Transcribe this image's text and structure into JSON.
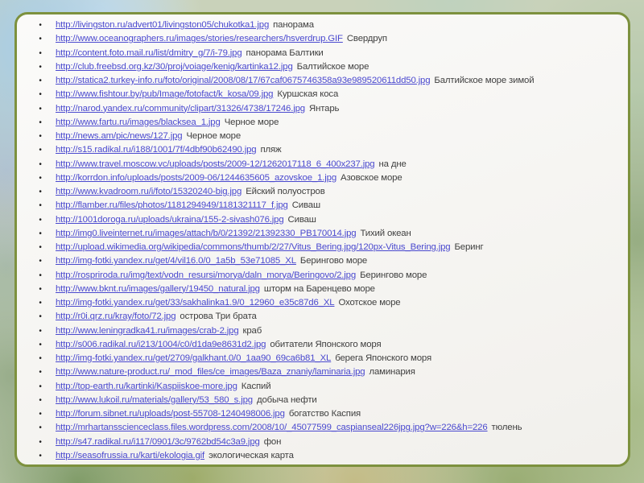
{
  "theme": {
    "link_color": "#4a49cf",
    "text_color": "#3f3f3f",
    "panel_bg": "#f5f4f1",
    "panel_border": "#7d913e",
    "bullet_color": "#1f1f1f"
  },
  "bullet_glyph": "•",
  "links": [
    {
      "url": "http://livingston.ru/advert01/livingston05/chukotka1.jpg",
      "label": "панорама"
    },
    {
      "url": "http://www.oceanographers.ru/images/stories/researchers/hsverdrup.GIF",
      "label": "Свердруп"
    },
    {
      "url": "http://content.foto.mail.ru/list/dmitry_g/7/i-79.jpg",
      "label": "панорама Балтики"
    },
    {
      "url": "http://club.freebsd.org.kz/30/proj/voiage/kenig/kartinka12.jpg",
      "label": "Балтийское море"
    },
    {
      "url": "http://statica2.turkey-info.ru/foto/original/2008/08/17/67caf0675746358a93e989520611dd50.jpg",
      "label": "Балтийское море зимой"
    },
    {
      "url": "http://www.fishtour.by/pub/Image/fotofact/k_kosa/09.jpg",
      "label": "Куршская коса"
    },
    {
      "url": "http://narod.yandex.ru/community/clipart/31326/4738/17246.jpg",
      "label": "Янтарь"
    },
    {
      "url": "http://www.fartu.ru/images/blacksea_1.jpg",
      "label": "Черное море"
    },
    {
      "url": "http://news.am/pic/news/127.jpg",
      "label": "Черное море"
    },
    {
      "url": "http://s15.radikal.ru/i188/1001/7f/4dbf90b62490.jpg",
      "label": "пляж"
    },
    {
      "url": "http://www.travel.moscow.vc/uploads/posts/2009-12/1262017118_6_400x237.jpg",
      "label": "на дне"
    },
    {
      "url": "http://korrdon.info/uploads/posts/2009-06/1244635605_azovskoe_1.jpg",
      "label": "Азовское море"
    },
    {
      "url": "http://www.kvadroom.ru/i/foto/15320240-big.jpg",
      "label": "Ейский полуостров"
    },
    {
      "url": "http://flamber.ru/files/photos/1181294949/1181321117_f.jpg",
      "label": "Сиваш"
    },
    {
      "url": "http://1001doroga.ru/uploads/ukraina/155-2-sivash076.jpg",
      "label": "Сиваш"
    },
    {
      "url": "http://img0.liveinternet.ru/images/attach/b/0/21392/21392330_PB170014.jpg",
      "label": "Тихий океан"
    },
    {
      "url": "http://upload.wikimedia.org/wikipedia/commons/thumb/2/27/Vitus_Bering.jpg/120px-Vitus_Bering.jpg",
      "label": "Беринг"
    },
    {
      "url": "http://img-fotki.yandex.ru/get/4/vil16.0/0_1a5b_53e71085_XL",
      "label": "Берингово море"
    },
    {
      "url": "http://rospriroda.ru/img/text/vodn_resursi/morya/daln_morya/Beringovo/2.jpg",
      "label": "Берингово море"
    },
    {
      "url": "http://www.bknt.ru/images/gallery/19450_natural.jpg",
      "label": "шторм на Баренцево море"
    },
    {
      "url": "http://img-fotki.yandex.ru/get/33/sakhalinka1.9/0_12960_e35c87d6_XL",
      "label": "Охотское море"
    },
    {
      "url": "http://r0i.qrz.ru/kray/foto/72.jpg",
      "label": "острова Три брата"
    },
    {
      "url": "http://www.leningradka41.ru/images/crab-2.jpg",
      "label": "краб"
    },
    {
      "url": "http://s006.radikal.ru/i213/1004/c0/d1da9e8631d2.jpg",
      "label": "обитатели Японского моря"
    },
    {
      "url": "http://img-fotki.yandex.ru/get/2709/galkhant.0/0_1aa90_69ca6b81_XL",
      "label": "берега Японского моря"
    },
    {
      "url": "http://www.nature-product.ru/_mod_files/ce_images/Baza_znaniy/laminaria.jpg",
      "label": "ламинария"
    },
    {
      "url": "http://top-earth.ru/kartinki/Kaspiiskoe-more.jpg",
      "label": "Каспий"
    },
    {
      "url": "http://www.lukoil.ru/materials/gallery/53_580_s.jpg",
      "label": "добыча нефти"
    },
    {
      "url": "http://forum.sibnet.ru/uploads/post-55708-1240498006.jpg",
      "label": "богатство Каспия"
    },
    {
      "url": "http://mrhartansscienceclass.files.wordpress.com/2008/10/_45077599_caspianseal226jpg.jpg?w=226&h=226",
      "label": "тюлень"
    },
    {
      "url": "http://s47.radikal.ru/i117/0901/3c/9762bd54c3a9.jpg",
      "label": "фон"
    },
    {
      "url": "http://seasofrussia.ru/karti/ekologia.gif",
      "label": "экологическая карта"
    }
  ]
}
